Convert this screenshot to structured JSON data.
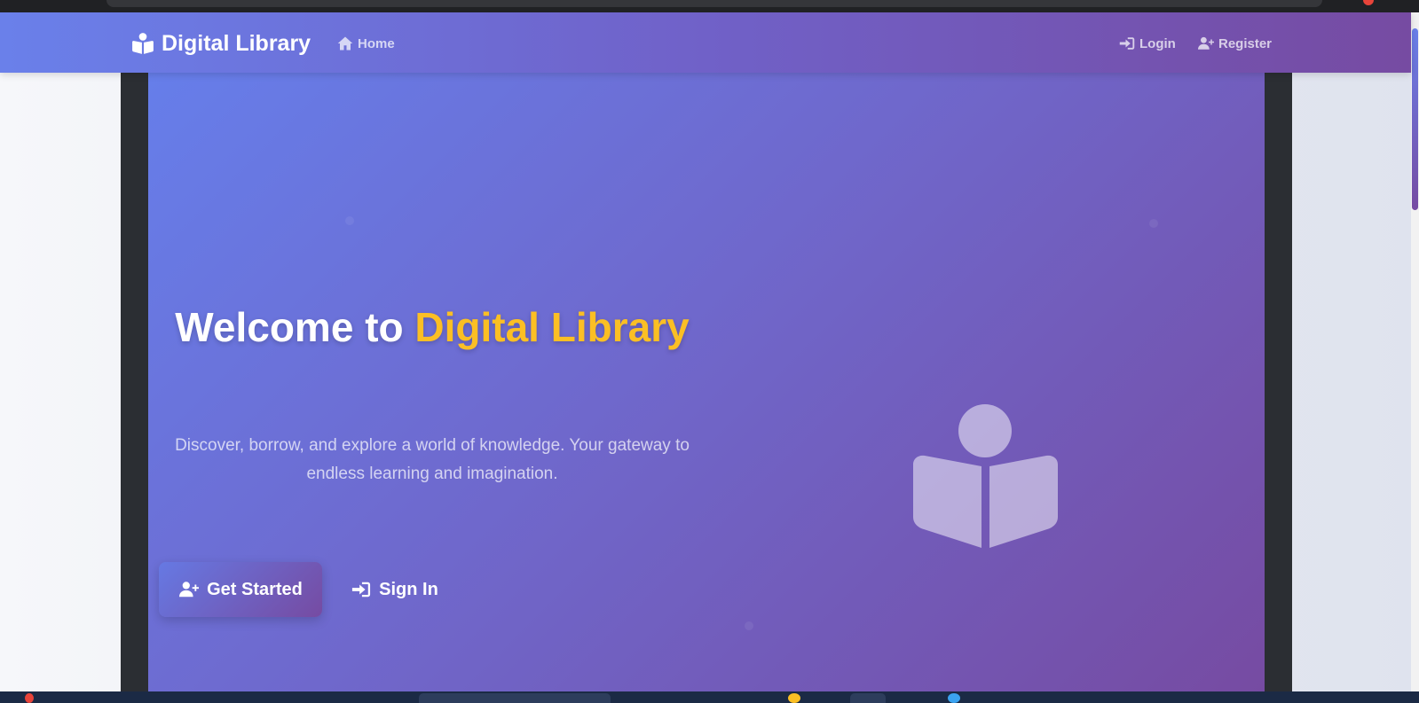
{
  "navbar": {
    "brand_icon": "reader-icon",
    "brand": "Digital Library",
    "home_label": "Home",
    "home_icon": "home-icon",
    "login_label": "Login",
    "login_icon": "sign-in-icon",
    "register_label": "Register",
    "register_icon": "user-plus-icon"
  },
  "hero": {
    "title_prefix": "Welcome to",
    "title_accent": "Digital Library",
    "subtitle": "Discover, borrow, and explore a world of knowledge. Your gateway to endless learning and imagination.",
    "primary_button": "Get Started",
    "primary_icon": "user-plus-icon",
    "secondary_button": "Sign In",
    "secondary_icon": "sign-in-icon",
    "illustration_icon": "book-reader-icon"
  },
  "colors": {
    "gradient_start": "#667eea",
    "gradient_end": "#764ba2",
    "accent": "#fbbf24"
  }
}
